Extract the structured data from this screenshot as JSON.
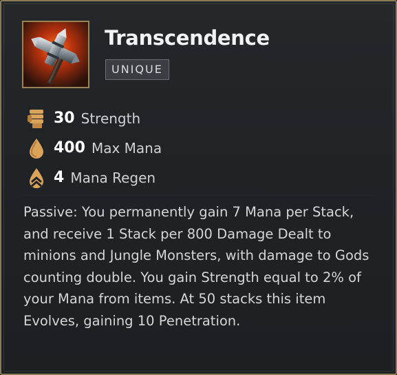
{
  "item": {
    "name": "Transcendence",
    "rarity": "UNIQUE",
    "icon": "transcendence-hammer-icon"
  },
  "stats": [
    {
      "value": "30",
      "label": "Strength",
      "icon": "fist-icon"
    },
    {
      "value": "400",
      "label": "Max Mana",
      "icon": "mana-drop-icon"
    },
    {
      "value": "4",
      "label": "Mana Regen",
      "icon": "mana-regen-icon"
    }
  ],
  "description": "Passive: You permanently gain 7 Mana per Stack, and receive 1 Stack per 800 Damage Dealt to minions and Jungle Monsters, with damage to Gods counting double. You gain Strength equal to 2% of your Mana from items. At 50 stacks this item Evolves, gaining 10 Penetration.",
  "colors": {
    "border": "#8c7a52",
    "background": "#1f2326",
    "stat_icon": "#d9a35a",
    "badge_bg": "#3a3e42"
  }
}
